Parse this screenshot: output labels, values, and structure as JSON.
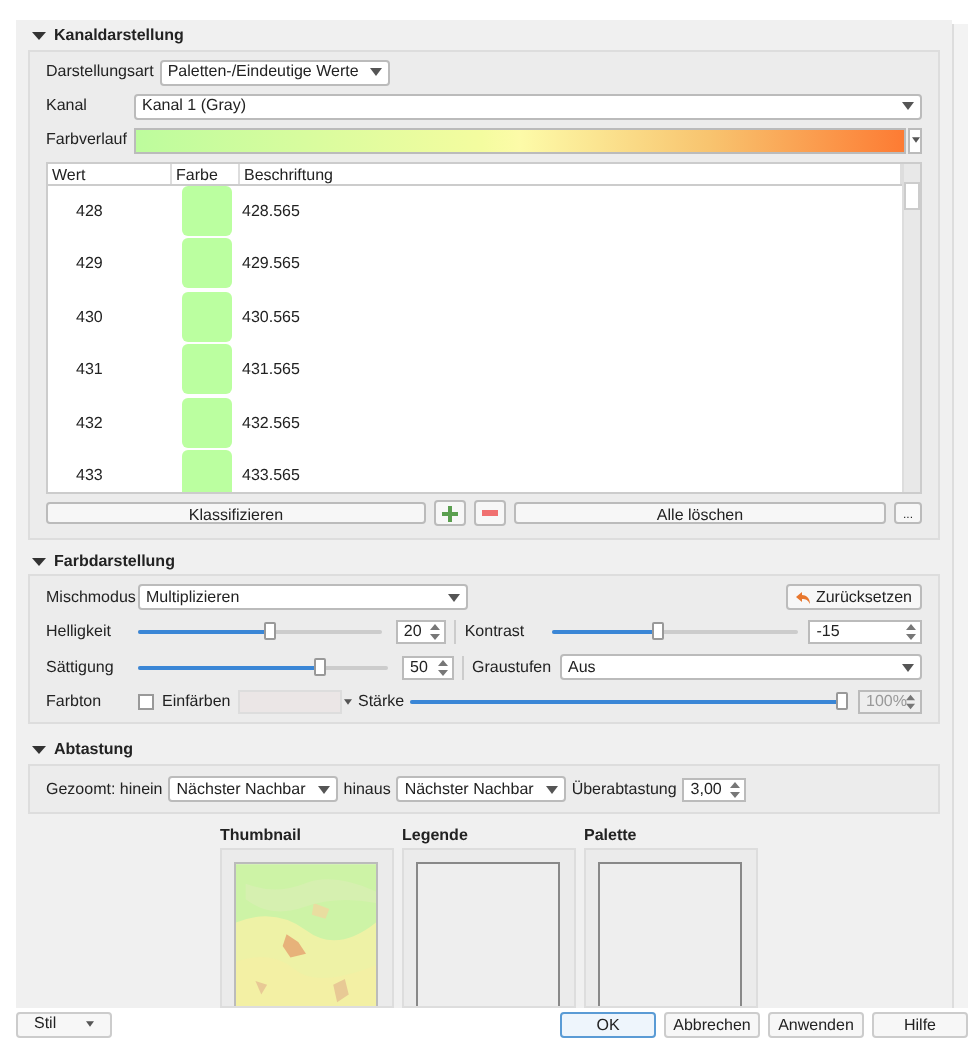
{
  "channel_section": {
    "title": "Kanaldarstellung",
    "expanded": true,
    "render_type": {
      "label": "Darstellungsart",
      "value": "Paletten-/Eindeutige Werte"
    },
    "band": {
      "label": "Kanal",
      "value": "Kanal 1 (Gray)"
    },
    "ramp": {
      "label": "Farbverlauf"
    },
    "table": {
      "columns": [
        "Wert",
        "Farbe",
        "Beschriftung"
      ],
      "rows": [
        {
          "value": "428",
          "color": "#bbffa0",
          "label": "428.565"
        },
        {
          "value": "429",
          "color": "#bbffa0",
          "label": "429.565"
        },
        {
          "value": "430",
          "color": "#bbffa0",
          "label": "430.565"
        },
        {
          "value": "431",
          "color": "#bbffa0",
          "label": "431.565"
        },
        {
          "value": "432",
          "color": "#bbffa0",
          "label": "432.565"
        },
        {
          "value": "433",
          "color": "#bbffa0",
          "label": "433.565"
        }
      ]
    },
    "buttons": {
      "classify": "Klassifizieren",
      "delete_all": "Alle löschen",
      "more": "..."
    }
  },
  "color_section": {
    "title": "Farbdarstellung",
    "expanded": true,
    "blend": {
      "label": "Mischmodus",
      "value": "Multiplizieren"
    },
    "reset": "Zurücksetzen",
    "brightness": {
      "label": "Helligkeit",
      "level": 0.54,
      "value": "20"
    },
    "contrast": {
      "label": "Kontrast",
      "level": 0.43,
      "value": "-15"
    },
    "saturation": {
      "label": "Sättigung",
      "level": 0.73,
      "value": "50"
    },
    "grayscale": {
      "label": "Graustufen",
      "value": "Aus"
    },
    "hue": {
      "label": "Farbton",
      "colorize_label": "Einfärben",
      "colorize": false
    },
    "strength": {
      "label": "Stärke",
      "level": 1.0,
      "value": "100%",
      "disabled": true
    }
  },
  "resampling_section": {
    "title": "Abtastung",
    "expanded": true,
    "zoomed_in": {
      "label": "Gezoomt: hinein",
      "value": "Nächster Nachbar"
    },
    "zoomed_out": {
      "label": "hinaus",
      "value": "Nächster Nachbar"
    },
    "oversampling": {
      "label": "Überabtastung",
      "value": "3,00"
    }
  },
  "previews": [
    {
      "title": "Thumbnail",
      "kind": "picture"
    },
    {
      "title": "Legende",
      "kind": "empty"
    },
    {
      "title": "Palette",
      "kind": "empty"
    }
  ],
  "footer": {
    "style": "Stil",
    "buttons": [
      {
        "label": "OK",
        "selected": true
      },
      {
        "label": "Abbrechen",
        "selected": false
      },
      {
        "label": "Anwenden",
        "selected": false
      },
      {
        "label": "Hilfe",
        "selected": false
      }
    ]
  }
}
